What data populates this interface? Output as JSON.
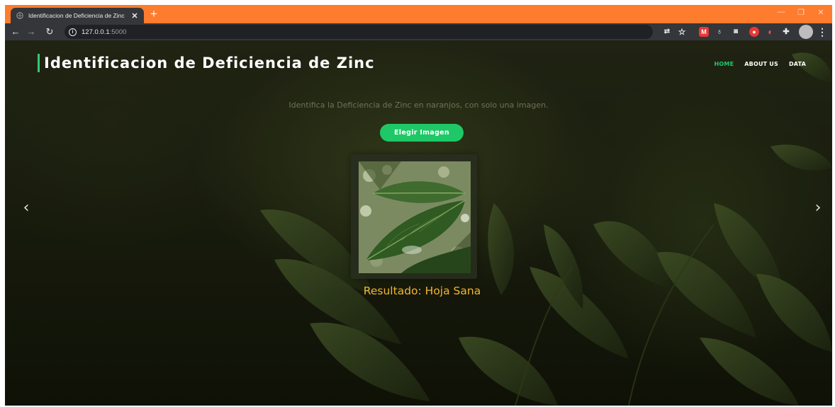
{
  "browser": {
    "tab_title": "Identificacion de Deficiencia de Zinc",
    "tab_close": "✕",
    "new_tab": "+",
    "url_host": "127.0.0.1",
    "url_port": ":5000",
    "icons": [
      "globe-icon",
      "back-icon",
      "forward-icon",
      "reload-icon",
      "info-icon",
      "translate-icon",
      "star-icon",
      "extension-icon",
      "profile-icon",
      "menu-icon"
    ]
  },
  "site": {
    "title": "Identificacion de Deficiencia de Zinc",
    "nav": [
      "HOME",
      "ABOUT US",
      "DATA"
    ],
    "subtitle": "Identifica la Deficiencia de Zinc en naranjos, con solo una imagen.",
    "choose_button": "Elegir Imagen",
    "result": "Resultado: Hoja Sana",
    "prev": "‹",
    "next": "›"
  },
  "colors": {
    "tab_strip": "#fd7c2d",
    "accent_green": "#1fc866",
    "result_text": "#f2b531"
  }
}
